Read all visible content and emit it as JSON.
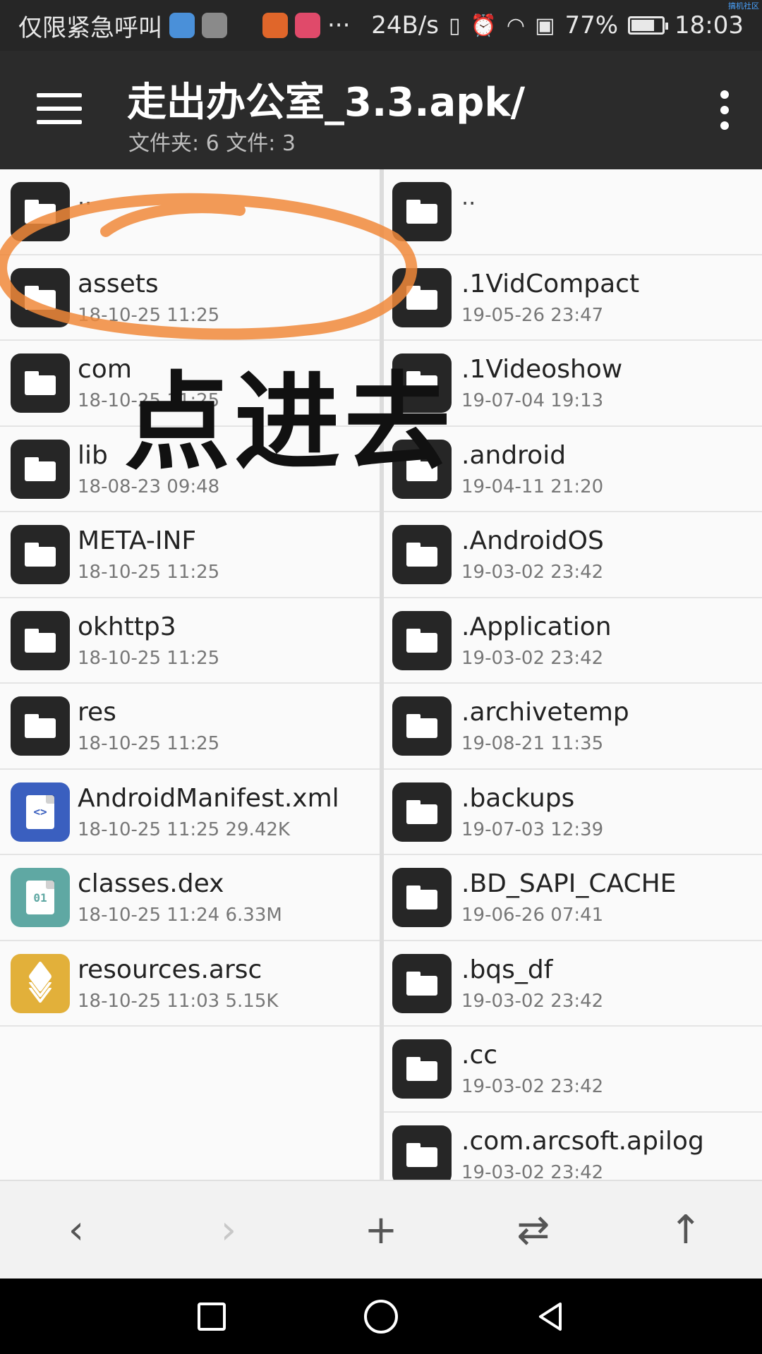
{
  "status_bar": {
    "carrier": "仅限紧急呼叫",
    "ellipsis": "···",
    "speed": "24B/s",
    "battery_percent": "77%",
    "battery_level": 0.77,
    "time": "18:03",
    "watermark": "搞机社区"
  },
  "toolbar": {
    "title": "走出办公室_3.3.apk/",
    "subtitle": "文件夹: 6  文件: 3"
  },
  "left_pane": {
    "parent": "..",
    "items": [
      {
        "name": "assets",
        "meta": "18-10-25 11:25",
        "type": "folder"
      },
      {
        "name": "com",
        "meta": "18-10-25 11:25",
        "type": "folder"
      },
      {
        "name": "lib",
        "meta": "18-08-23 09:48",
        "type": "folder"
      },
      {
        "name": "META-INF",
        "meta": "18-10-25 11:25",
        "type": "folder"
      },
      {
        "name": "okhttp3",
        "meta": "18-10-25 11:25",
        "type": "folder"
      },
      {
        "name": "res",
        "meta": "18-10-25 11:25",
        "type": "folder"
      },
      {
        "name": "AndroidManifest.xml",
        "meta": "18-10-25 11:25  29.42K",
        "type": "xml",
        "glyph": "<>"
      },
      {
        "name": "classes.dex",
        "meta": "18-10-25 11:24  6.33M",
        "type": "dex",
        "glyph": "01"
      },
      {
        "name": "resources.arsc",
        "meta": "18-10-25 11:03  5.15K",
        "type": "arsc"
      }
    ]
  },
  "right_pane": {
    "parent": "..",
    "items": [
      {
        "name": ".1VidCompact",
        "meta": "19-05-26 23:47"
      },
      {
        "name": ".1Videoshow",
        "meta": "19-07-04 19:13"
      },
      {
        "name": ".android",
        "meta": "19-04-11 21:20"
      },
      {
        "name": ".AndroidOS",
        "meta": "19-03-02 23:42"
      },
      {
        "name": ".Application",
        "meta": "19-03-02 23:42"
      },
      {
        "name": ".archivetemp",
        "meta": "19-08-21 11:35"
      },
      {
        "name": ".backups",
        "meta": "19-07-03 12:39"
      },
      {
        "name": ".BD_SAPI_CACHE",
        "meta": "19-06-26 07:41"
      },
      {
        "name": ".bqs_df",
        "meta": "19-03-02 23:42"
      },
      {
        "name": ".cc",
        "meta": "19-03-02 23:42"
      },
      {
        "name": ".com.arcsoft.apilog",
        "meta": "19-03-02 23:42"
      }
    ]
  },
  "annotation": {
    "text": "点进去",
    "circle_color": "#f0883a"
  },
  "bottom_bar": {
    "back": "‹",
    "forward": "›",
    "add": "+",
    "swap": "⇄",
    "up": "↑"
  },
  "colors": {
    "toolbar": "#2b2b2b",
    "xml_icon": "#3a5fbf",
    "dex_icon": "#5fa8a3",
    "arsc_icon": "#e2b03a"
  }
}
